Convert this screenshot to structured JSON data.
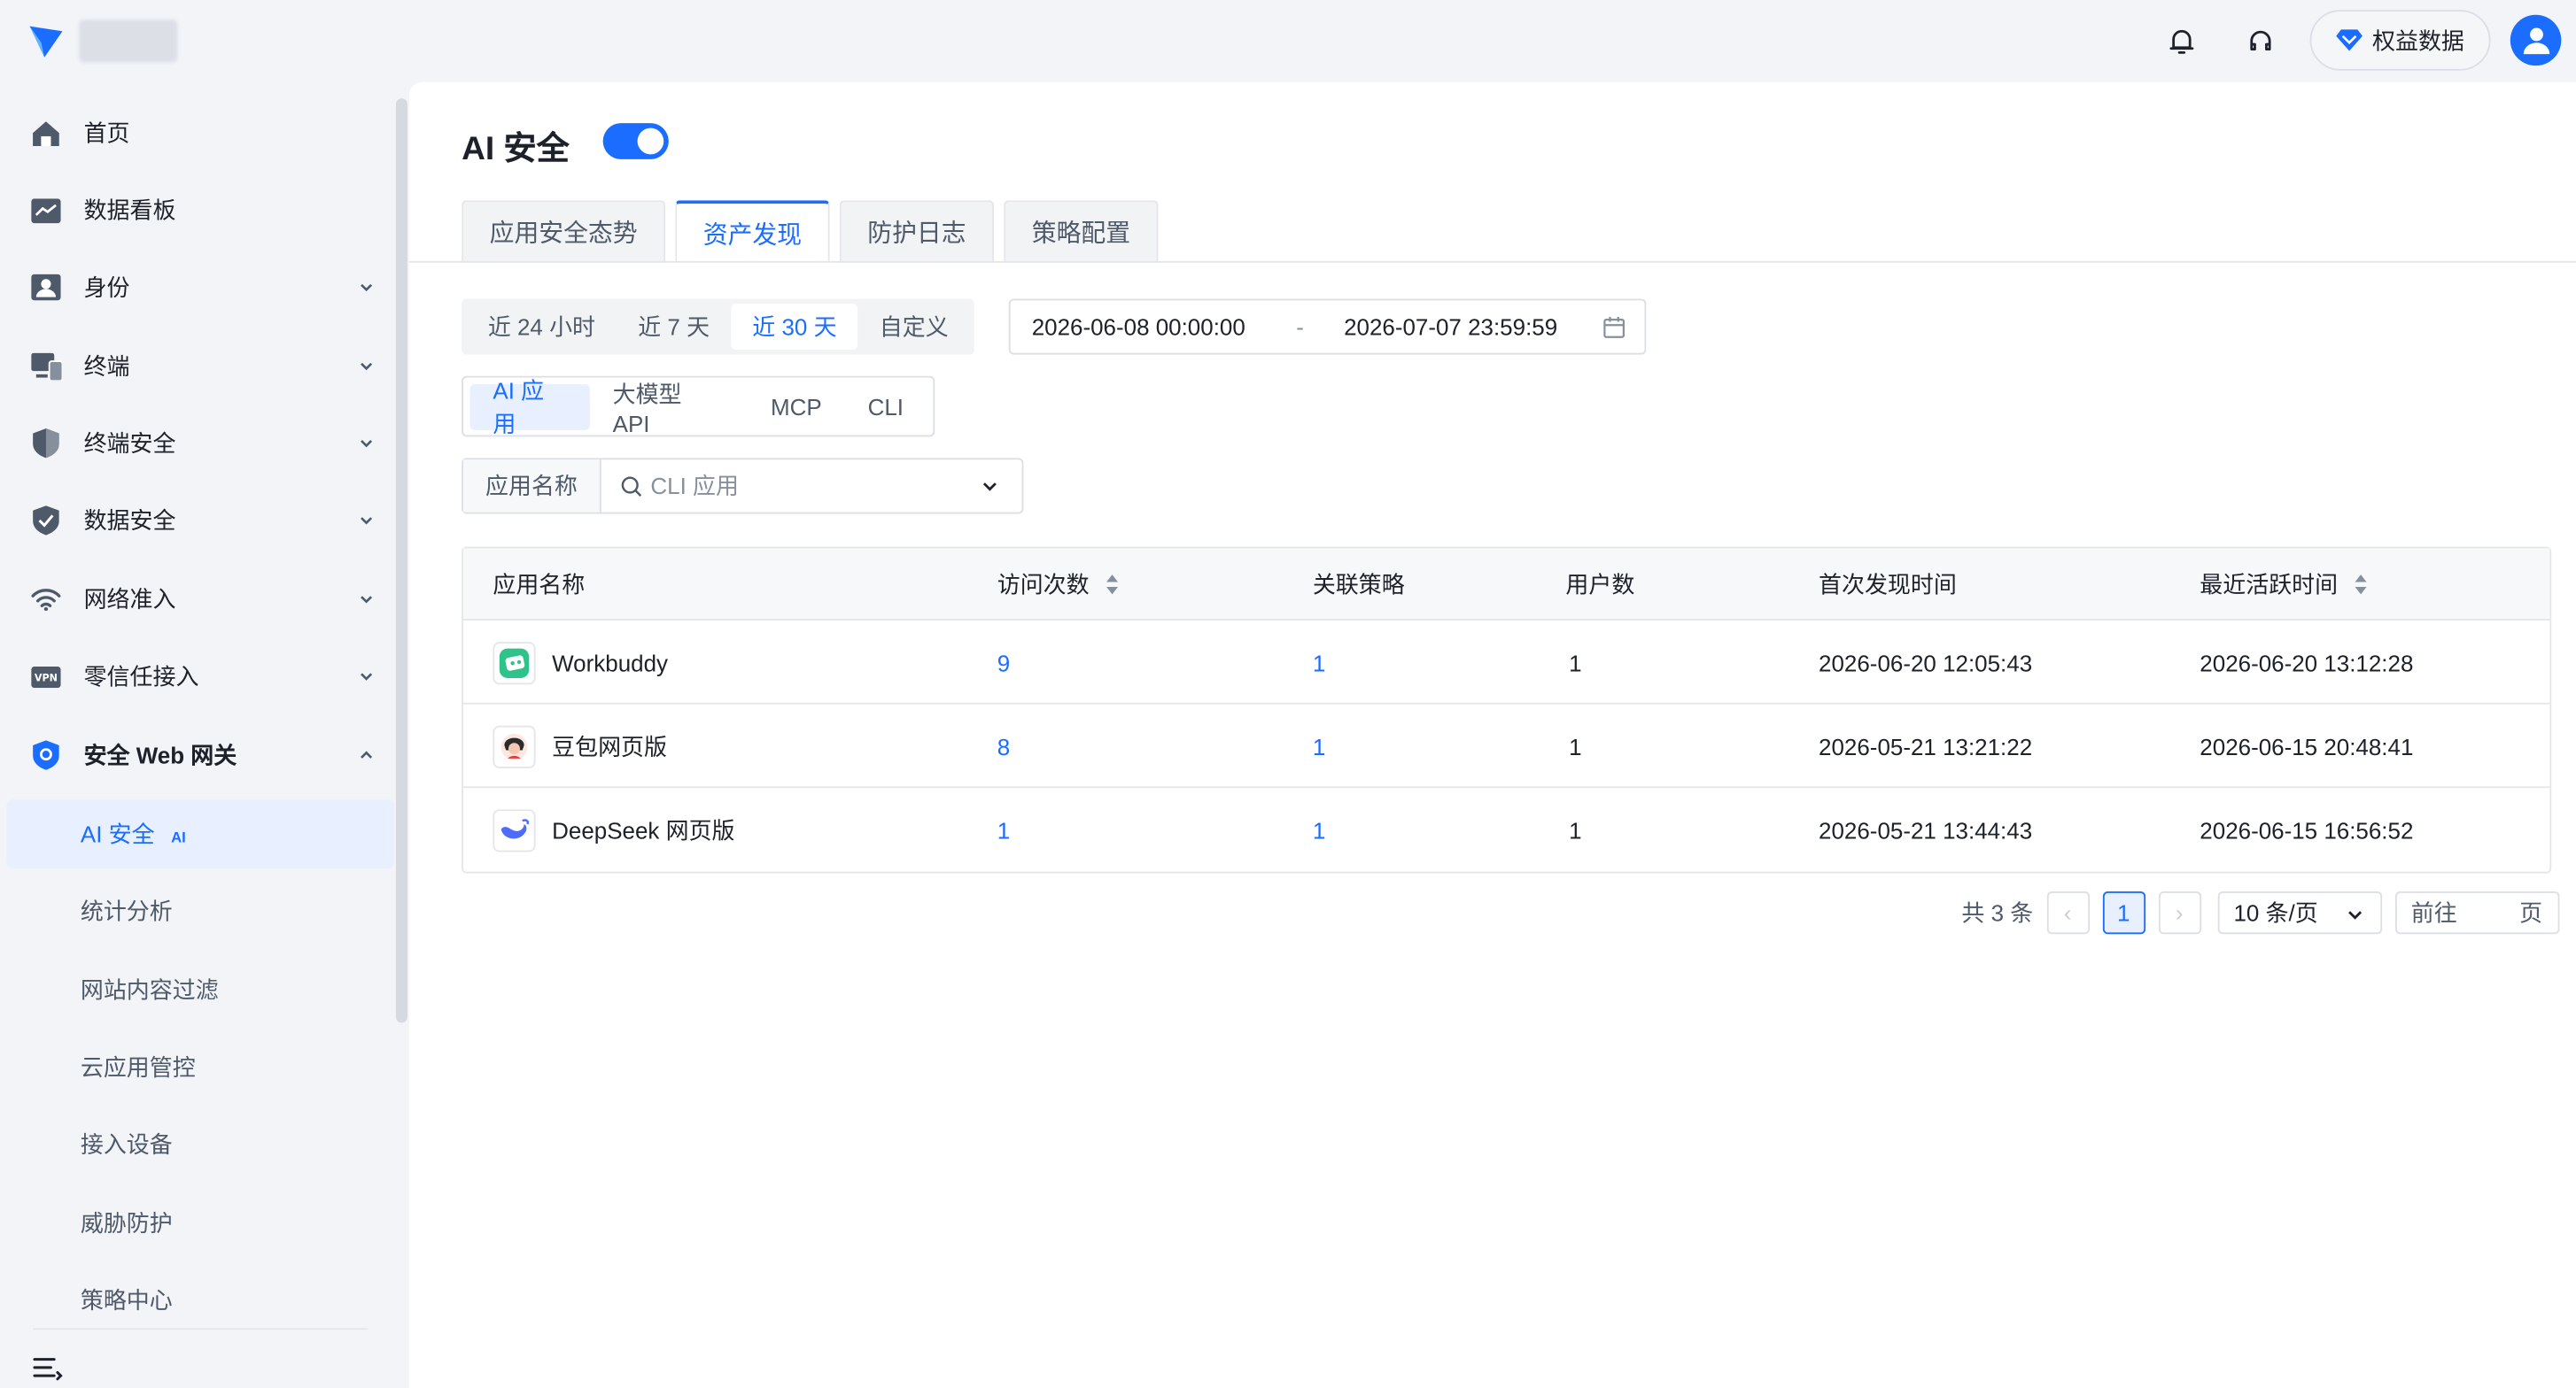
{
  "topbar": {
    "rights_label": "权益数据"
  },
  "sidebar": {
    "items": [
      {
        "label": "首页",
        "icon": "home-icon"
      },
      {
        "label": "数据看板",
        "icon": "dashboard-icon"
      },
      {
        "label": "身份",
        "icon": "identity-icon"
      },
      {
        "label": "终端",
        "icon": "terminal-icon"
      },
      {
        "label": "终端安全",
        "icon": "shield-icon"
      },
      {
        "label": "数据安全",
        "icon": "data-shield-icon"
      },
      {
        "label": "网络准入",
        "icon": "wifi-icon"
      },
      {
        "label": "零信任接入",
        "icon": "vpn-icon"
      },
      {
        "label": "安全 Web 网关",
        "icon": "gateway-shield-icon"
      }
    ],
    "vpn_text": "VPN",
    "sub_items": [
      {
        "label": "AI 安全",
        "badge": "AI"
      },
      {
        "label": "统计分析"
      },
      {
        "label": "网站内容过滤"
      },
      {
        "label": "云应用管控"
      },
      {
        "label": "接入设备"
      },
      {
        "label": "威胁防护"
      },
      {
        "label": "策略中心"
      }
    ]
  },
  "main": {
    "title": "AI 安全",
    "toggle_on": true,
    "tabs": [
      {
        "label": "应用安全态势"
      },
      {
        "label": "资产发现",
        "active": true
      },
      {
        "label": "防护日志"
      },
      {
        "label": "策略配置"
      }
    ],
    "ranges": [
      "近 24 小时",
      "近 7 天",
      "近 30 天",
      "自定义"
    ],
    "active_range": "近 30 天",
    "date_start": "2026-06-08 00:00:00",
    "date_sep": "-",
    "date_end": "2026-07-07 23:59:59",
    "types": [
      "AI 应用",
      "大模型 API",
      "MCP",
      "CLI"
    ],
    "active_type": "AI 应用",
    "filter": {
      "label": "应用名称",
      "placeholder": "CLI 应用"
    },
    "table": {
      "headers": [
        "应用名称",
        "访问次数",
        "关联策略",
        "用户数",
        "首次发现时间",
        "最近活跃时间"
      ],
      "rows": [
        {
          "name": "Workbuddy",
          "visits": "9",
          "policies": "1",
          "users": "1",
          "first_seen": "2026-06-20 12:05:43",
          "last_active": "2026-06-20 13:12:28"
        },
        {
          "name": "豆包网页版",
          "visits": "8",
          "policies": "1",
          "users": "1",
          "first_seen": "2026-05-21 13:21:22",
          "last_active": "2026-06-15 20:48:41"
        },
        {
          "name": "DeepSeek 网页版",
          "visits": "1",
          "policies": "1",
          "users": "1",
          "first_seen": "2026-05-21 13:44:43",
          "last_active": "2026-06-15 16:56:52"
        }
      ]
    },
    "pagination": {
      "total": "共 3 条",
      "prev": "‹",
      "current": "1",
      "next": "›",
      "page_size": "10 条/页",
      "goto_prefix": "前往",
      "goto_suffix": "页"
    }
  },
  "colors": {
    "accent": "#1a6dff",
    "background": "#f2f4f8",
    "active_bg": "#e8f0ff"
  }
}
